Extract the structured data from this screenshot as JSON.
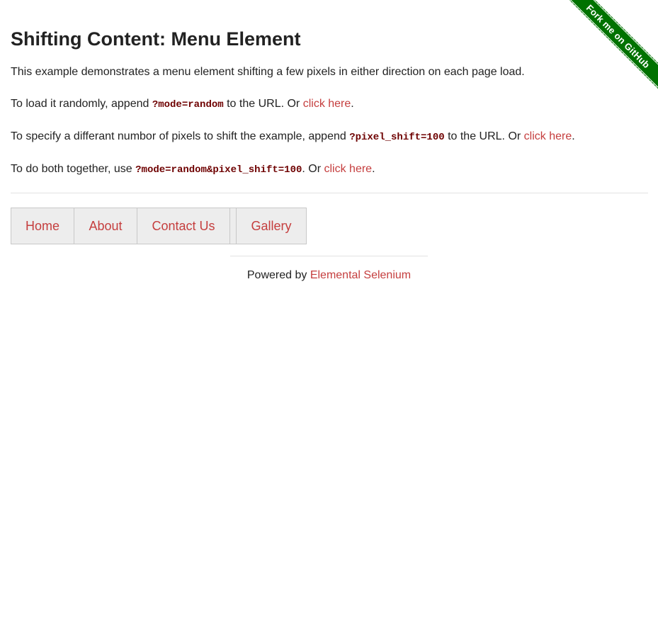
{
  "ribbon": {
    "label": "Fork me on GitHub",
    "color": "#007200"
  },
  "page": {
    "title": "Shifting Content: Menu Element"
  },
  "intro": {
    "text": "This example demonstrates a menu element shifting a few pixels in either direction on each page load."
  },
  "random_para": {
    "before": "To load it randomly, append ",
    "code": "?mode=random",
    "after": " to the URL. Or ",
    "link": "click here",
    "end": "."
  },
  "pixel_para": {
    "before": "To specify a differant numbor of pixels to shift the example, append ",
    "code": "?pixel_shift=100",
    "after": " to the URL. Or ",
    "link": "click here",
    "end": "."
  },
  "both_para": {
    "before": "To do both together, use ",
    "code": "?mode=random&pixel_shift=100",
    "after": ". Or ",
    "link": "click here",
    "end": "."
  },
  "menu": {
    "items": [
      {
        "label": "Home"
      },
      {
        "label": "About"
      },
      {
        "label": "Contact Us"
      },
      {
        "label": ""
      },
      {
        "label": "Gallery"
      }
    ]
  },
  "footer": {
    "prefix": "Powered by ",
    "link": "Elemental Selenium"
  },
  "colors": {
    "link": "#c53e3e",
    "code": "#6e0000",
    "menu_bg": "#ededed",
    "text": "#222222"
  }
}
